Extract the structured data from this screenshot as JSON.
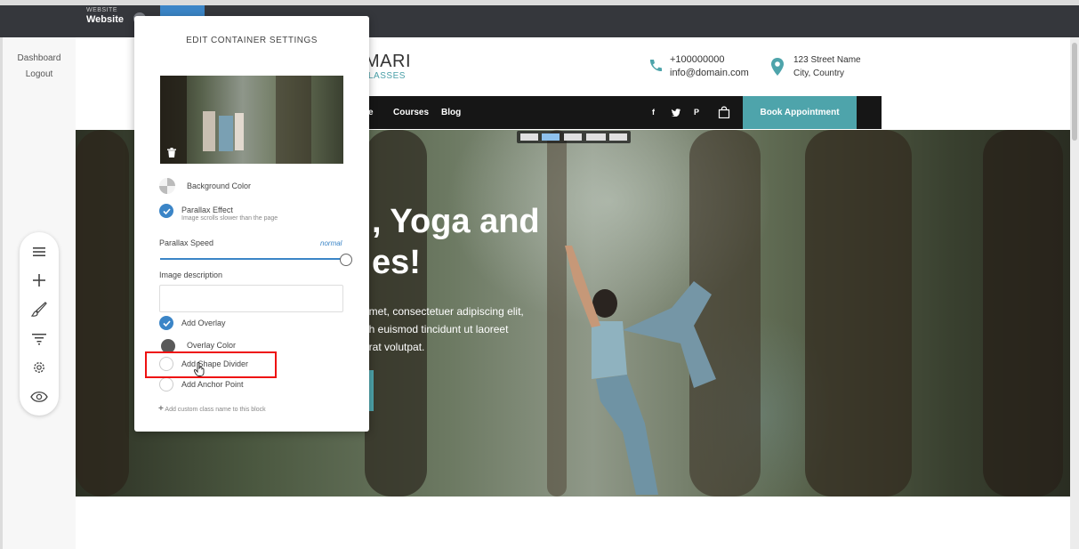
{
  "topbar": {
    "section_small": "WEBSITE",
    "section_title": "Website"
  },
  "left_nav": {
    "dashboard": "Dashboard",
    "logout": "Logout"
  },
  "toolbox": {
    "icons": [
      "menu-icon",
      "plus-icon",
      "brush-icon",
      "filter-icon",
      "gear-icon",
      "eye-icon"
    ]
  },
  "site": {
    "logo_name": "MARI",
    "logo_sub": "LASSES",
    "phone": "+100000000",
    "email": "info@domain.com",
    "address_line1": "123 Street Name",
    "address_line2": "City, Country",
    "nav": {
      "partial": "e",
      "courses": "Courses",
      "blog": "Blog"
    },
    "social": {
      "facebook": "f",
      "twitter": "♥",
      "pinterest": "P"
    },
    "book_button": "Book Appointment",
    "hero_heading_line1": ", Yoga and",
    "hero_heading_line2": "es!",
    "hero_text_line1": "amet, consectetuer adipiscing elit,",
    "hero_text_line2": "bh euismod tincidunt ut laoreet",
    "hero_text_line3": "erat volutpat.",
    "accent_color": "#4ea4ab"
  },
  "panel": {
    "title": "EDIT CONTAINER SETTINGS",
    "background_color_label": "Background Color",
    "parallax_label": "Parallax Effect",
    "parallax_sub": "Image scrolls slower than the page",
    "parallax_speed_label": "Parallax Speed",
    "parallax_speed_value": "normal",
    "image_description_label": "Image description",
    "image_description_value": "",
    "add_overlay_label": "Add Overlay",
    "overlay_color_label": "Overlay Color",
    "shape_divider_label": "Add Shape Divider",
    "anchor_point_label": "Add Anchor Point",
    "add_class_label": "Add custom class name to this block",
    "parallax_checked": true,
    "overlay_checked": true,
    "shape_divider_checked": false,
    "anchor_checked": false,
    "accent_color": "#3b85c7",
    "highlight_color": "#e11111"
  }
}
